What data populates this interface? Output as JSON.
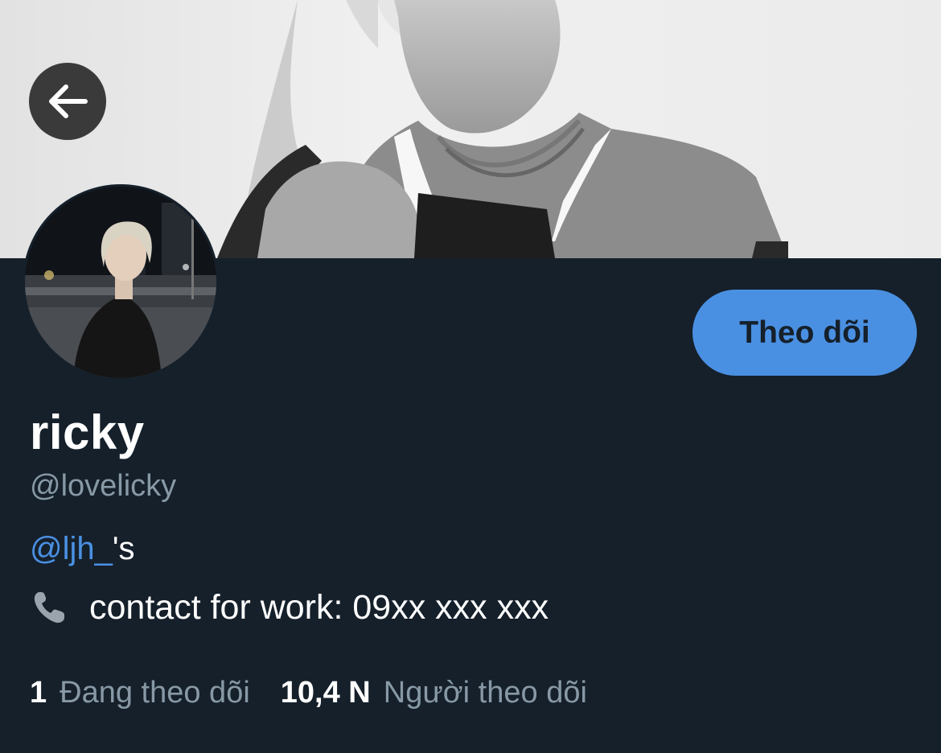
{
  "profile": {
    "display_name": "ricky",
    "handle": "@lovelicky",
    "bio_mention": "@ljh_",
    "bio_suffix": "'s",
    "contact_text": "contact for work: 09xx xxx xxx"
  },
  "actions": {
    "follow_label": "Theo dõi"
  },
  "stats": {
    "following_count": "1",
    "following_label": "Đang theo dõi",
    "followers_count": "10,4 N",
    "followers_label": "Người theo dõi"
  },
  "icons": {
    "back": "arrow-left-icon",
    "contact": "phone-icon"
  },
  "colors": {
    "background": "#15202b",
    "accent": "#4a90e2",
    "secondary_text": "#8899a6"
  }
}
